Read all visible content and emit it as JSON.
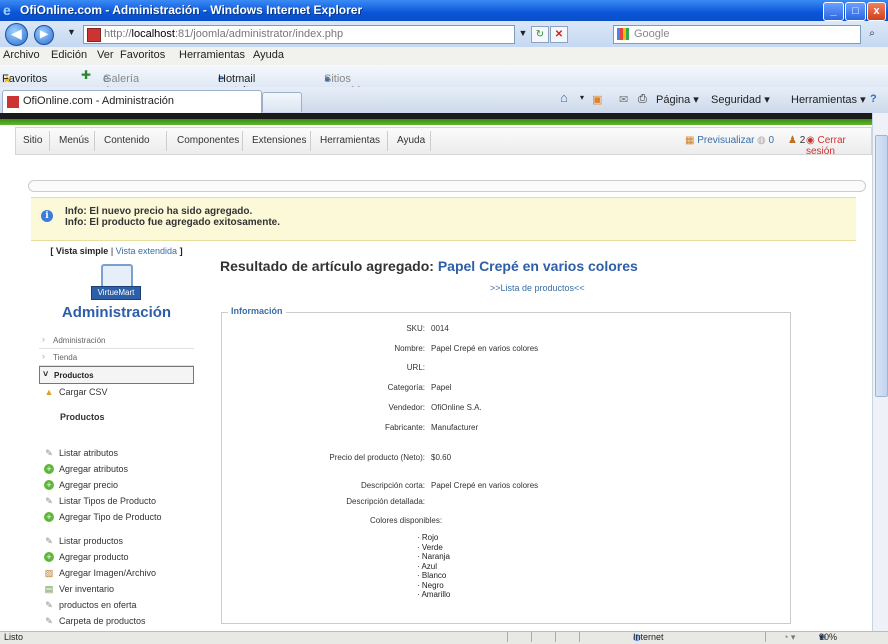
{
  "window": {
    "title": "OfiOnline.com - Administración - Windows Internet Explorer",
    "minimize_label": "_",
    "maximize_label": "□",
    "close_label": "x"
  },
  "address_bar": {
    "url_prefix": "http://",
    "url_host": "localhost",
    "url_rest": ":81/joomla/administrator/index.php",
    "search_placeholder": "Google"
  },
  "menu_bar": [
    "Archivo",
    "Edición",
    "Ver",
    "Favoritos",
    "Herramientas",
    "Ayuda"
  ],
  "favorites_bar": {
    "favorites_label": "Favoritos",
    "items": [
      "Galería de Web Slice ▾",
      "Hotmail gratuito",
      "Sitios sugeridos ▾"
    ]
  },
  "tab": {
    "title": "OfiOnline.com - Administración"
  },
  "command_bar": {
    "page": "Página ▾",
    "safety": "Seguridad ▾",
    "tools": "Herramientas ▾"
  },
  "joomla_menu": {
    "items": [
      "Sitio",
      "Menús",
      "Contenido",
      "Componentes",
      "Extensiones",
      "Herramientas",
      "Ayuda"
    ],
    "preview": "Previsualizar",
    "messages": "0",
    "users": "2",
    "logout": "Cerrar sesión"
  },
  "info": {
    "line1": "Info: El nuevo precio ha sido agregado.",
    "line2": "Info: El producto fue agregado exitosamente."
  },
  "sidebar": {
    "view_open": "[",
    "view_simple": "Vista simple",
    "view_sep": "|",
    "view_extended": "Vista extendida",
    "view_close": "]",
    "logo_text": "VirtueMart",
    "title": "Administración",
    "sections": [
      "Administración",
      "Tienda",
      "Productos"
    ],
    "upload_csv": "Cargar CSV",
    "products_heading": "Productos",
    "links_group1": [
      "Listar atributos",
      "Agregar atributos",
      "Agregar precio",
      "Listar Tipos de Producto",
      "Agregar Tipo de Producto"
    ],
    "links_group2": [
      "Listar productos",
      "Agregar producto",
      "Agregar Imagen/Archivo",
      "Ver inventario",
      "productos en oferta",
      "Carpeta de productos"
    ]
  },
  "main": {
    "heading_prefix": "Resultado de artículo agregado:",
    "heading_product": "Papel Crepé en varios colores",
    "product_list_link": ">>Lista de productos<<",
    "fieldset_legend": "Información",
    "fields": [
      {
        "label": "SKU:",
        "value": "0014"
      },
      {
        "label": "Nombre:",
        "value": "Papel Crepé en varios colores"
      },
      {
        "label": "URL:",
        "value": ""
      },
      {
        "label": "Categoría:",
        "value": "Papel"
      },
      {
        "label": "Vendedor:",
        "value": "OfiOnline S.A."
      },
      {
        "label": "Fabricante:",
        "value": "Manufacturer"
      },
      {
        "label": "Precio del producto (Neto):",
        "value": "$0.60"
      },
      {
        "label": "Descripción corta:",
        "value": "Papel Crepé en varios colores"
      },
      {
        "label": "Descripción detallada:",
        "value": ""
      }
    ],
    "colors_heading": "Colores disponibles:",
    "colors": [
      "Rojo",
      "Verde",
      "Naranja",
      "Azul",
      "Blanco",
      "Negro",
      "Amarillo"
    ]
  },
  "status_bar": {
    "status": "Listo",
    "zone": "Internet",
    "zoom": "90%"
  }
}
